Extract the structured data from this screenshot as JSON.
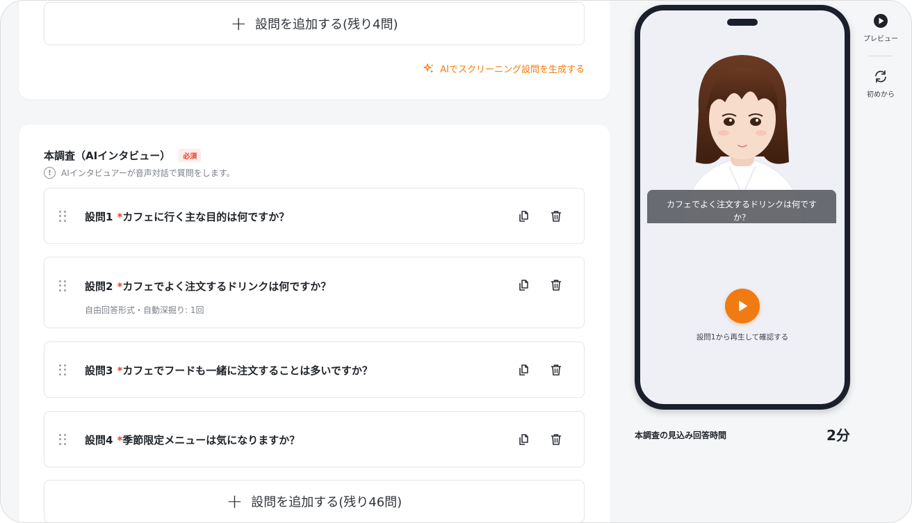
{
  "screening": {
    "add_question_label": "設問を追加する(残り4問)",
    "ai_generate_label": "AIでスクリーニング設問を生成する"
  },
  "main_survey": {
    "title": "本調査（AIインタビュー）",
    "required_badge": "必須",
    "note": "AIインタビュアーが音声対話で質問をします。",
    "questions": [
      {
        "number": "設問1",
        "text": "カフェに行く主な目的は何ですか？",
        "subtext": ""
      },
      {
        "number": "設問2",
        "text": "カフェでよく注文するドリンクは何ですか？",
        "subtext": "自由回答形式・自動深掘り: 1回"
      },
      {
        "number": "設問3",
        "text": "カフェでフードも一緒に注文することは多いですか？",
        "subtext": ""
      },
      {
        "number": "設問4",
        "text": "季節限定メニューは気になりますか？",
        "subtext": ""
      }
    ],
    "add_question_label": "設問を追加する(残り46問)"
  },
  "preview": {
    "caption": "カフェでよく注文するドリンクは何ですか？",
    "play_hint": "設問1から再生して確認する",
    "estimate_label": "本調査の見込み回答時間",
    "estimate_value": "2分"
  },
  "tools": {
    "preview_label": "プレビュー",
    "restart_label": "初めから"
  },
  "colors": {
    "accent": "#f07b12",
    "required": "#e5432a",
    "phone_frame": "#1b1f2c"
  }
}
